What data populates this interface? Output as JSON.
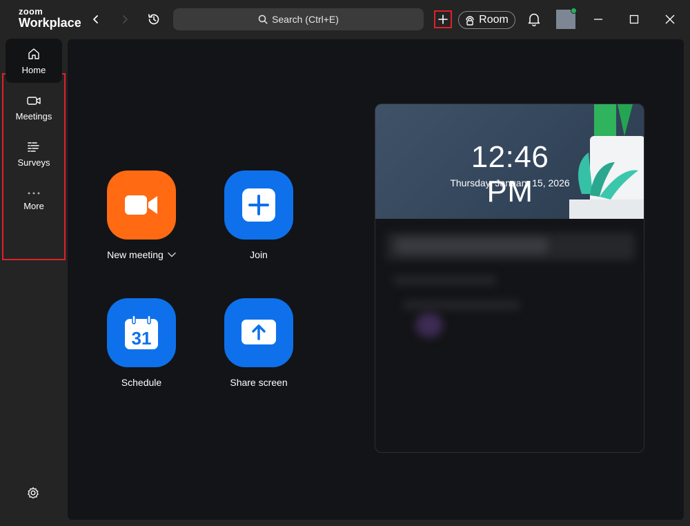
{
  "app": {
    "logo_top": "zoom",
    "logo_bottom": "Workplace"
  },
  "titlebar": {
    "search_placeholder": "Search (Ctrl+E)",
    "room_label": "Room",
    "presence_color": "#1fb35a"
  },
  "sidebar": {
    "items": [
      {
        "label": "Home",
        "icon": "home-icon",
        "active": true
      },
      {
        "label": "Meetings",
        "icon": "video-camera-icon",
        "active": false
      },
      {
        "label": "Surveys",
        "icon": "survey-icon",
        "active": false
      },
      {
        "label": "More",
        "icon": "more-dots-icon",
        "active": false
      }
    ],
    "settings_icon": "gear-icon"
  },
  "actions": [
    {
      "label": "New meeting",
      "icon": "video-camera-icon",
      "color": "#ff6a13",
      "has_dropdown": true
    },
    {
      "label": "Join",
      "icon": "plus-icon",
      "color": "#0e71eb"
    },
    {
      "label": "Schedule",
      "icon": "calendar-icon",
      "color": "#0e71eb",
      "calendar_day": "31"
    },
    {
      "label": "Share screen",
      "icon": "share-up-arrow-icon",
      "color": "#0e71eb"
    }
  ],
  "calendar_card": {
    "time": "12:46 PM",
    "date": "Thursday, January 15, 2026"
  },
  "colors": {
    "highlight": "#e0212a",
    "accent_blue": "#0e71eb",
    "accent_orange": "#ff6a13"
  }
}
